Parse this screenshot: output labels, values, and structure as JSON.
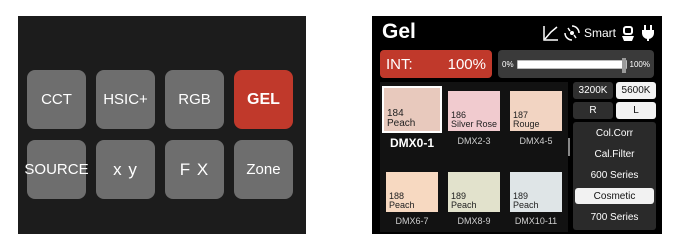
{
  "left_panel": {
    "buttons": [
      "CCT",
      "HSIC+",
      "RGB",
      "GEL",
      "SOURCE",
      "x y",
      "F X",
      "Zone"
    ],
    "active": "GEL"
  },
  "right_panel": {
    "title": "Gel",
    "smart_label": "Smart",
    "intensity": {
      "label": "INT:",
      "value": "100%"
    },
    "slider": {
      "min_label": "0%",
      "max_label": "100%",
      "level_percent": 100
    },
    "gels": [
      {
        "number": "184",
        "name": "Peach",
        "dmx": "DMX0-1",
        "color": "#e8c9bd",
        "selected": true
      },
      {
        "number": "186",
        "name": "Silver Rose",
        "dmx": "DMX2-3",
        "color": "#f1cbcf",
        "selected": false
      },
      {
        "number": "187",
        "name": "Rouge",
        "dmx": "DMX4-5",
        "color": "#f2d4c2",
        "selected": false
      },
      {
        "number": "188",
        "name": "Peach",
        "dmx": "DMX6-7",
        "color": "#f7d9c1",
        "selected": false
      },
      {
        "number": "189",
        "name": "Peach",
        "dmx": "DMX8-9",
        "color": "#e2e2cc",
        "selected": false
      },
      {
        "number": "189",
        "name": "Peach",
        "dmx": "DMX10-11",
        "color": "#dfe5e7",
        "selected": false
      }
    ],
    "cct_options": [
      "3200K",
      "5600K"
    ],
    "cct_active": "5600K",
    "rl_options": [
      "R",
      "L"
    ],
    "rl_active": "L",
    "categories": [
      "Col.Corr",
      "Cal.Filter",
      "600 Series",
      "Cosmetic",
      "700 Series"
    ],
    "category_active": "Cosmetic",
    "colors": {
      "accent_red": "#c0392b",
      "button_gray": "#6e6e6e"
    }
  }
}
